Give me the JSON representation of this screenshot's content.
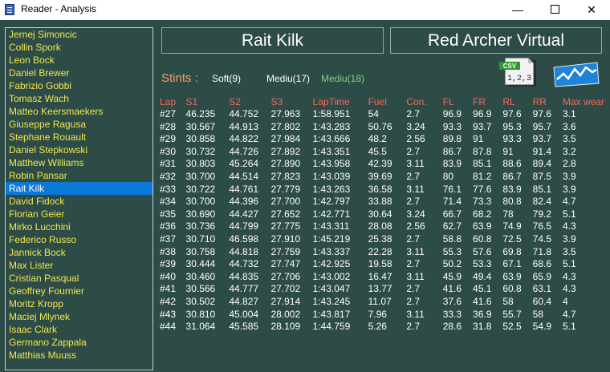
{
  "window": {
    "title": "Reader - Analysis"
  },
  "drivers": [
    "Jernej Simoncic",
    "Collin Spork",
    "Leon Bock",
    "Daniel Brewer",
    "Fabrizio Gobbi",
    "Tomasz Wach",
    "Matteo Keersmaekers",
    "Giuseppe Ragusa",
    "Stephane Rouault",
    "Daniel Stepkowski",
    "Matthew Williams",
    "Robin Pansar",
    "Rait Kilk",
    "David Fidock",
    "Florian Geier",
    "Mirko Lucchini",
    "Federico Russo",
    "Jannick Bock",
    "Max Lister",
    "Cristian Pasqual",
    "Geoffrey Fournier",
    "Moritz Kropp",
    "Maciej Mlynek",
    "Isaac Clark",
    "Germano Zappala",
    "Matthias Muuss"
  ],
  "selected_driver_index": 12,
  "header": {
    "driver": "Rait Kilk",
    "team": "Red Archer Virtual"
  },
  "stints": {
    "label": "Stints :",
    "items": [
      {
        "text": "Soft(9)",
        "color": "#ffffff"
      },
      {
        "text": "Mediu(17)",
        "color": "#ffffff"
      },
      {
        "text": "Mediu(18)",
        "color": "#7ed37e"
      }
    ]
  },
  "icons": {
    "csv": "csv-export-icon",
    "chart": "chart-icon",
    "csv_text": "CSV",
    "csv_sub": "1,2,3"
  },
  "table": {
    "columns": [
      "Lap",
      "S1",
      "S2",
      "S3",
      "LapTime",
      "Fuel",
      "Con.",
      "FL",
      "FR",
      "RL",
      "RR",
      "Max wear"
    ],
    "rows": [
      [
        "#27",
        "46.235",
        "44.752",
        "27.963",
        "1:58.951",
        "54",
        "2.7",
        "96.9",
        "96.9",
        "97.6",
        "97.6",
        "3.1"
      ],
      [
        "#28",
        "30.567",
        "44.913",
        "27.802",
        "1:43.283",
        "50.76",
        "3.24",
        "93.3",
        "93.7",
        "95.3",
        "95.7",
        "3.6"
      ],
      [
        "#29",
        "30.858",
        "44.822",
        "27.984",
        "1:43.666",
        "48.2",
        "2.56",
        "89.8",
        "91",
        "93.3",
        "93.7",
        "3.5"
      ],
      [
        "#30",
        "30.732",
        "44.726",
        "27.892",
        "1:43.351",
        "45.5",
        "2.7",
        "86.7",
        "87.8",
        "91",
        "91.4",
        "3.2"
      ],
      [
        "#31",
        "30.803",
        "45.264",
        "27.890",
        "1:43.958",
        "42.39",
        "3.11",
        "83.9",
        "85.1",
        "88.6",
        "89.4",
        "2.8"
      ],
      [
        "#32",
        "30.700",
        "44.514",
        "27.823",
        "1:43.039",
        "39.69",
        "2.7",
        "80",
        "81.2",
        "86.7",
        "87.5",
        "3.9"
      ],
      [
        "#33",
        "30.722",
        "44.761",
        "27.779",
        "1:43.263",
        "36.58",
        "3.11",
        "76.1",
        "77.6",
        "83.9",
        "85.1",
        "3.9"
      ],
      [
        "#34",
        "30.700",
        "44.396",
        "27.700",
        "1:42.797",
        "33.88",
        "2.7",
        "71.4",
        "73.3",
        "80.8",
        "82.4",
        "4.7"
      ],
      [
        "#35",
        "30.690",
        "44.427",
        "27.652",
        "1:42.771",
        "30.64",
        "3.24",
        "66.7",
        "68.2",
        "78",
        "79.2",
        "5.1"
      ],
      [
        "#36",
        "30.736",
        "44.799",
        "27.775",
        "1:43.311",
        "28.08",
        "2.56",
        "62.7",
        "63.9",
        "74.9",
        "76.5",
        "4.3"
      ],
      [
        "#37",
        "30.710",
        "46.598",
        "27.910",
        "1:45.219",
        "25.38",
        "2.7",
        "58.8",
        "60.8",
        "72.5",
        "74.5",
        "3.9"
      ],
      [
        "#38",
        "30.758",
        "44.818",
        "27.759",
        "1:43.337",
        "22.28",
        "3.11",
        "55.3",
        "57.6",
        "69.8",
        "71.8",
        "3.5"
      ],
      [
        "#39",
        "30.444",
        "44.732",
        "27.747",
        "1:42.925",
        "19.58",
        "2.7",
        "50.2",
        "53.3",
        "67.1",
        "68.6",
        "5.1"
      ],
      [
        "#40",
        "30.460",
        "44.835",
        "27.706",
        "1:43.002",
        "16.47",
        "3.11",
        "45.9",
        "49.4",
        "63.9",
        "65.9",
        "4.3"
      ],
      [
        "#41",
        "30.566",
        "44.777",
        "27.702",
        "1:43.047",
        "13.77",
        "2.7",
        "41.6",
        "45.1",
        "60.8",
        "63.1",
        "4.3"
      ],
      [
        "#42",
        "30.502",
        "44.827",
        "27.914",
        "1:43.245",
        "11.07",
        "2.7",
        "37.6",
        "41.6",
        "58",
        "60.4",
        "4"
      ],
      [
        "#43",
        "30.810",
        "45.004",
        "28.002",
        "1:43.817",
        "7.96",
        "3.11",
        "33.3",
        "36.9",
        "55.7",
        "58",
        "4.7"
      ],
      [
        "#44",
        "31.064",
        "45.585",
        "28.109",
        "1:44.759",
        "5.26",
        "2.7",
        "28.6",
        "31.8",
        "52.5",
        "54.9",
        "5.1"
      ]
    ]
  }
}
